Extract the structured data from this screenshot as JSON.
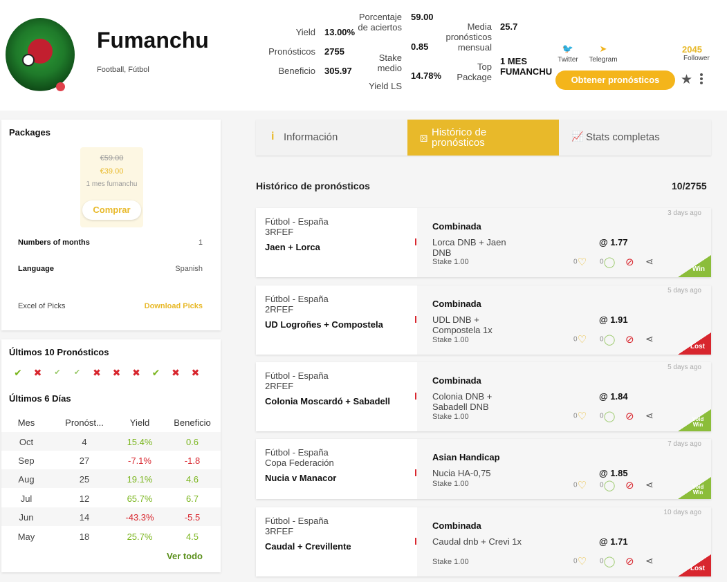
{
  "profile": {
    "name": "Fumanchu",
    "sports": "Football, Fútbol",
    "status_color": "#e0414b"
  },
  "stats": {
    "yield_label": "Yield",
    "yield_value": "13.00%",
    "picks_label": "Pronósticos",
    "picks_value": "2755",
    "profit_label": "Beneficio",
    "profit_value": "305.97",
    "hit_label": "Porcentaje de aciertos",
    "hit_value": "59.00",
    "stake_label": "Stake medio",
    "stake_value": "0.85",
    "yield_ls_label": "Yield LS",
    "yield_ls_value": "14.78%",
    "monthly_label": "Media pronósticos mensual",
    "monthly_value": "25.7",
    "top_package_label": "Top Package",
    "top_package_value": "1 MES FUMANCHU"
  },
  "social": {
    "twitter_label": "Twitter",
    "telegram_label": "Telegram",
    "followers_count": "2045",
    "followers_label": "Follower"
  },
  "header_actions": {
    "cta_label": "Obtener pronósticos"
  },
  "packages": {
    "title": "Packages",
    "old_price": "€59.00",
    "price": "€39.00",
    "name": "1 mes fumanchu",
    "buy_label": "Comprar",
    "months_label": "Numbers of months",
    "months_value": "1",
    "language_label": "Language",
    "language_value": "Spanish",
    "excel_label": "Excel of Picks",
    "download_label": "Download Picks"
  },
  "last_picks": {
    "title": "Últimos 10 Pronósticos",
    "results": [
      "W",
      "L",
      "V",
      "V",
      "L",
      "L",
      "L",
      "W",
      "L",
      "L"
    ],
    "days_title": "Últimos 6 Días",
    "columns": [
      "Mes",
      "Pronóst...",
      "Yield",
      "Beneficio"
    ],
    "rows": [
      {
        "month": "Oct",
        "picks": "4",
        "yield": "15.4%",
        "profit": "0.6",
        "sign": "pos"
      },
      {
        "month": "Sep",
        "picks": "27",
        "yield": "-7.1%",
        "profit": "-1.8",
        "sign": "neg"
      },
      {
        "month": "Aug",
        "picks": "25",
        "yield": "19.1%",
        "profit": "4.6",
        "sign": "pos"
      },
      {
        "month": "Jul",
        "picks": "12",
        "yield": "65.7%",
        "profit": "6.7",
        "sign": "pos"
      },
      {
        "month": "Jun",
        "picks": "14",
        "yield": "-43.3%",
        "profit": "-5.5",
        "sign": "neg"
      },
      {
        "month": "May",
        "picks": "18",
        "yield": "25.7%",
        "profit": "4.5",
        "sign": "pos"
      }
    ],
    "see_all_label": "Ver todo"
  },
  "tabs": [
    {
      "label": "Información",
      "icon": "info-icon"
    },
    {
      "label": "Histórico de pronósticos",
      "icon": "dice-icon"
    },
    {
      "label": "Stats completas",
      "icon": "chart-icon"
    }
  ],
  "history": {
    "title": "Histórico de pronósticos",
    "count": "10/2755",
    "picks": [
      {
        "sport": "Fútbol - España",
        "competition": "3RFEF",
        "match": "Jaen + Lorca",
        "type": "Combinada",
        "description": "Lorca DNB + Jaen DNB",
        "stake": "Stake 1.00",
        "odds": "@ 1.77",
        "time": "3 days ago",
        "likes": "0",
        "comments": "0",
        "result": "Win"
      },
      {
        "sport": "Fútbol - España",
        "competition": "2RFEF",
        "match": "UD Logroñes + Compostela",
        "type": "Combinada",
        "description": "UDL DNB + Compostela 1x",
        "stake": "Stake 1.00",
        "odds": "@ 1.91",
        "time": "5 days ago",
        "likes": "0",
        "comments": "0",
        "result": "Lost"
      },
      {
        "sport": "Fútbol - España",
        "competition": "2RFEF",
        "match": "Colonia Moscardó + Sabadell",
        "type": "Combinada",
        "description": "Colonia DNB + Sabadell DNB",
        "stake": "Stake 1.00",
        "odds": "@ 1.84",
        "time": "5 days ago",
        "likes": "0",
        "comments": "0",
        "result": "Void Win"
      },
      {
        "sport": "Fútbol - España",
        "competition": "Copa Federación",
        "match": "Nucia v Manacor",
        "type": "Asian Handicap",
        "description": "Nucia HA-0,75",
        "stake": "Stake 1.00",
        "odds": "@ 1.85",
        "time": "7 days ago",
        "likes": "0",
        "comments": "0",
        "result": "Void Win"
      },
      {
        "sport": "Fútbol - España",
        "competition": "3RFEF",
        "match": "Caudal + Crevillente",
        "type": "Combinada",
        "description": "Caudal dnb + Crevi 1x",
        "stake": "Stake 1.00",
        "odds": "@ 1.71",
        "time": "10 days ago",
        "likes": "0",
        "comments": "0",
        "result": "Lost"
      }
    ]
  },
  "colors": {
    "accent": "#e8b92a",
    "cta": "#f4b51b",
    "positive": "#7ab51d",
    "negative": "#d8262e"
  }
}
